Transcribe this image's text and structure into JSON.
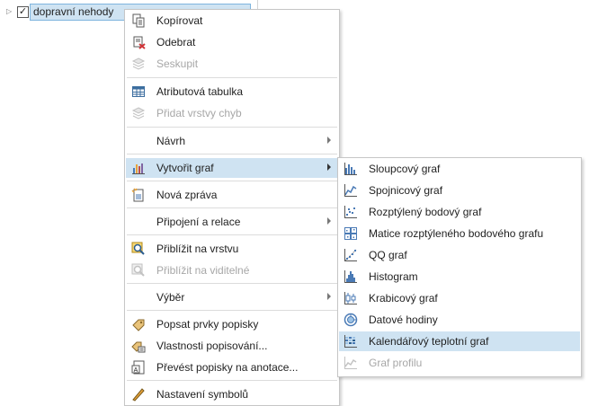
{
  "layer": {
    "name": "dopravní nehody",
    "checked": true
  },
  "main_menu": {
    "items": [
      {
        "label": "Kopírovat"
      },
      {
        "label": "Odebrat"
      },
      {
        "label": "Seskupit"
      },
      {
        "label": "Atributová tabulka"
      },
      {
        "label": "Přidat vrstvy chyb"
      },
      {
        "label": "Návrh"
      },
      {
        "label": "Vytvořit graf"
      },
      {
        "label": "Nová zpráva"
      },
      {
        "label": "Připojení a relace"
      },
      {
        "label": "Přiblížit na vrstvu"
      },
      {
        "label": "Přiblížit na viditelné"
      },
      {
        "label": "Výběr"
      },
      {
        "label": "Popsat prvky popisky"
      },
      {
        "label": "Vlastnosti popisování..."
      },
      {
        "label": "Převést popisky na anotace..."
      },
      {
        "label": "Nastavení symbolů"
      }
    ]
  },
  "sub_menu": {
    "items": [
      {
        "label": "Sloupcový graf"
      },
      {
        "label": "Spojnicový graf"
      },
      {
        "label": "Rozptýlený bodový graf"
      },
      {
        "label": "Matice rozptýleného bodového grafu"
      },
      {
        "label": "QQ graf"
      },
      {
        "label": "Histogram"
      },
      {
        "label": "Krabicový graf"
      },
      {
        "label": "Datové hodiny"
      },
      {
        "label": "Kalendářový teplotní graf"
      },
      {
        "label": "Graf profilu"
      }
    ]
  },
  "colors": {
    "highlight": "#cfe3f2",
    "highlight_border": "#7eb4de",
    "disabled_text": "#a7a7a7"
  }
}
